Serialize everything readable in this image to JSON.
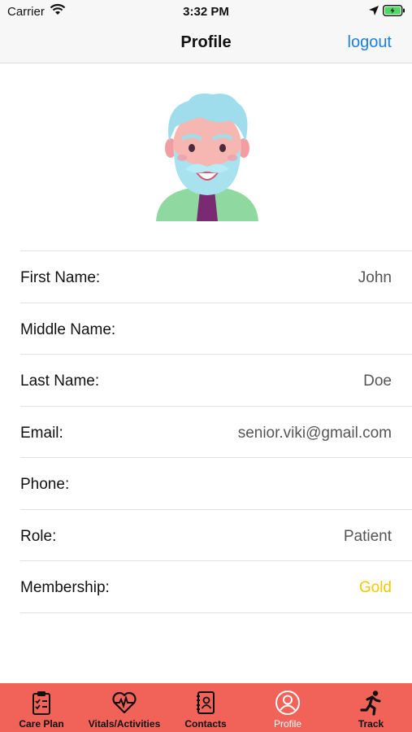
{
  "status_bar": {
    "carrier": "Carrier",
    "time": "3:32 PM"
  },
  "nav": {
    "title": "Profile",
    "logout_label": "logout"
  },
  "profile": {
    "rows": [
      {
        "label": "First Name:",
        "value": "John"
      },
      {
        "label": "Middle Name:",
        "value": ""
      },
      {
        "label": "Last Name:",
        "value": "Doe"
      },
      {
        "label": "Email:",
        "value": "senior.viki@gmail.com"
      },
      {
        "label": "Phone:",
        "value": ""
      },
      {
        "label": "Role:",
        "value": "Patient"
      },
      {
        "label": "Membership:",
        "value": "Gold"
      }
    ]
  },
  "tabs": [
    {
      "label": "Care Plan",
      "icon": "clipboard-icon"
    },
    {
      "label": "Vitals/Activities",
      "icon": "heartbeat-icon"
    },
    {
      "label": "Contacts",
      "icon": "address-book-icon"
    },
    {
      "label": "Profile",
      "icon": "user-circle-icon",
      "active": true
    },
    {
      "label": "Track",
      "icon": "running-icon"
    }
  ],
  "colors": {
    "tab_bar": "#f16258",
    "link": "#1a7fe0",
    "membership_gold": "#f2c800"
  }
}
